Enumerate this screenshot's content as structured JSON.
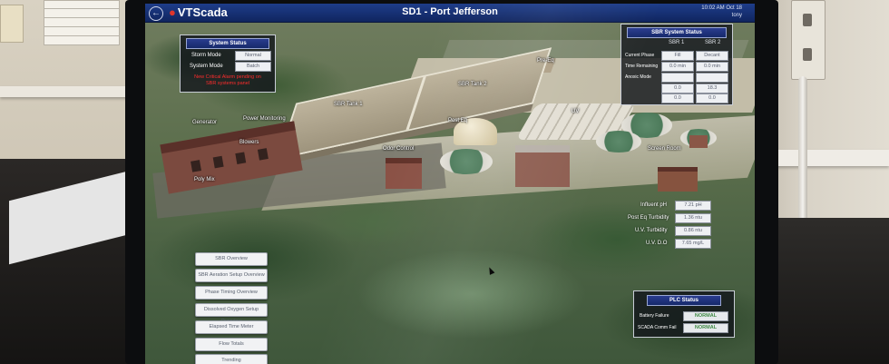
{
  "app": {
    "logo": "VTScada",
    "screen_title": "SD1 - Port Jefferson",
    "clock_time": "10:02 AM  Oct 18",
    "clock_user": "tony",
    "back_icon": "back-arrow-icon"
  },
  "map_labels": {
    "sbr_tank_1": "SBR Tank 1",
    "sbr_tank_2": "SBR Tank 2",
    "pre_eq": "Pre-Eq",
    "generator": "Generator",
    "power_monitoring": "Power Monitoring",
    "blowers": "Blowers",
    "poly_mix": "Poly Mix",
    "odor_control": "Odor Control",
    "post_eq": "Post Eq",
    "uv": "UV",
    "screen_room": "Screen Room"
  },
  "system_status": {
    "title": "System Status",
    "rows": [
      {
        "label": "Storm Mode",
        "value": "Normal"
      },
      {
        "label": "System Mode",
        "value": "Batch"
      }
    ],
    "alarm_line1": "New Critical Alarm pending on",
    "alarm_line2": "SBR systems panel"
  },
  "sbr_status": {
    "title": "SBR System Status",
    "col1": "SBR 1",
    "col2": "SBR 2",
    "rows": [
      {
        "label": "Current Phase",
        "v1": "Fill",
        "v2": "Decant"
      },
      {
        "label": "Time Remaining",
        "v1": "0.0 min",
        "v2": "0.0 min"
      },
      {
        "label": "Anoxic Mode",
        "v1": "",
        "v2": ""
      },
      {
        "label": "",
        "v1": "0.0",
        "v2": "18.3"
      },
      {
        "label": "",
        "v1": "0.0",
        "v2": "0.0"
      }
    ]
  },
  "readings": [
    {
      "label": "Influent pH",
      "value": "7.21 pH"
    },
    {
      "label": "Post Eq Turbidity",
      "value": "1.36 ntu"
    },
    {
      "label": "U.V. Turbidity",
      "value": "0.86 ntu"
    },
    {
      "label": "U.V. D.O",
      "value": "7.65 mg/L"
    }
  ],
  "nav_buttons": [
    "SBR Overview",
    "SBR Aeration Setup Overview",
    "Phase Timing Overview",
    "Dissolved Oxygen Setup Overview",
    "Elapsed Time Meter",
    "Flow Totals",
    "Trending"
  ],
  "plc_status": {
    "title": "PLC Status",
    "rows": [
      {
        "label": "Battery Failure",
        "value": "NORMAL"
      },
      {
        "label": "SCADA Comm Fail",
        "value": "NORMAL"
      }
    ]
  },
  "colors": {
    "title_bar": "#1e3d8a",
    "alarm_red": "#ff2c2c",
    "normal_green": "#3f8a45",
    "logo_red": "#e0352b"
  }
}
